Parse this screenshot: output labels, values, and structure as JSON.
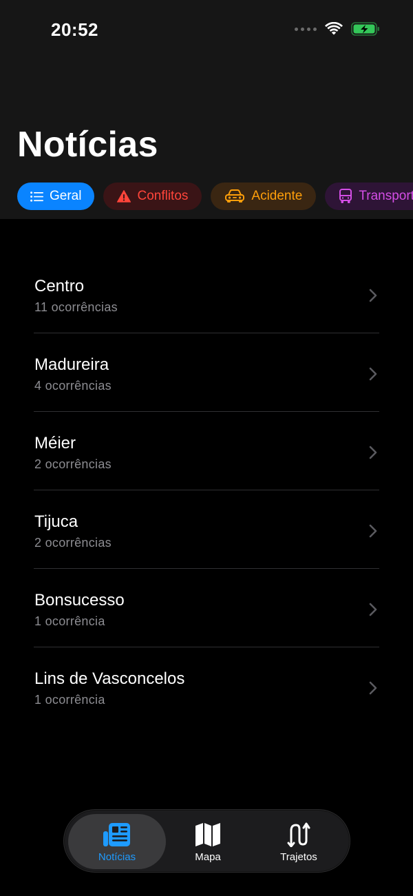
{
  "status_bar": {
    "time": "20:52"
  },
  "page": {
    "title": "Notícias"
  },
  "filters": [
    {
      "label": "Geral",
      "icon": "list-icon",
      "color": "#0a84ff",
      "selected": true
    },
    {
      "label": "Conflitos",
      "icon": "warning-icon",
      "color": "#ff453a",
      "selected": false
    },
    {
      "label": "Acidente",
      "icon": "car-icon",
      "color": "#ff9f0a",
      "selected": false
    },
    {
      "label": "Transporte",
      "icon": "bus-icon",
      "color": "#d44ee6",
      "selected": false
    }
  ],
  "neighborhoods": [
    {
      "name": "Centro",
      "count": "11 ocorrências"
    },
    {
      "name": "Madureira",
      "count": "4 ocorrências"
    },
    {
      "name": "Méier",
      "count": "2 ocorrências"
    },
    {
      "name": "Tijuca",
      "count": "2 ocorrências"
    },
    {
      "name": "Bonsucesso",
      "count": "1 ocorrência"
    },
    {
      "name": "Lins de Vasconcelos",
      "count": "1 ocorrência"
    }
  ],
  "tabbar": {
    "tabs": [
      {
        "label": "Notícias",
        "icon": "newspaper-icon",
        "active": true
      },
      {
        "label": "Mapa",
        "icon": "map-icon",
        "active": false
      },
      {
        "label": "Trajetos",
        "icon": "route-icon",
        "active": false
      }
    ],
    "accent": "#1e9bff"
  }
}
